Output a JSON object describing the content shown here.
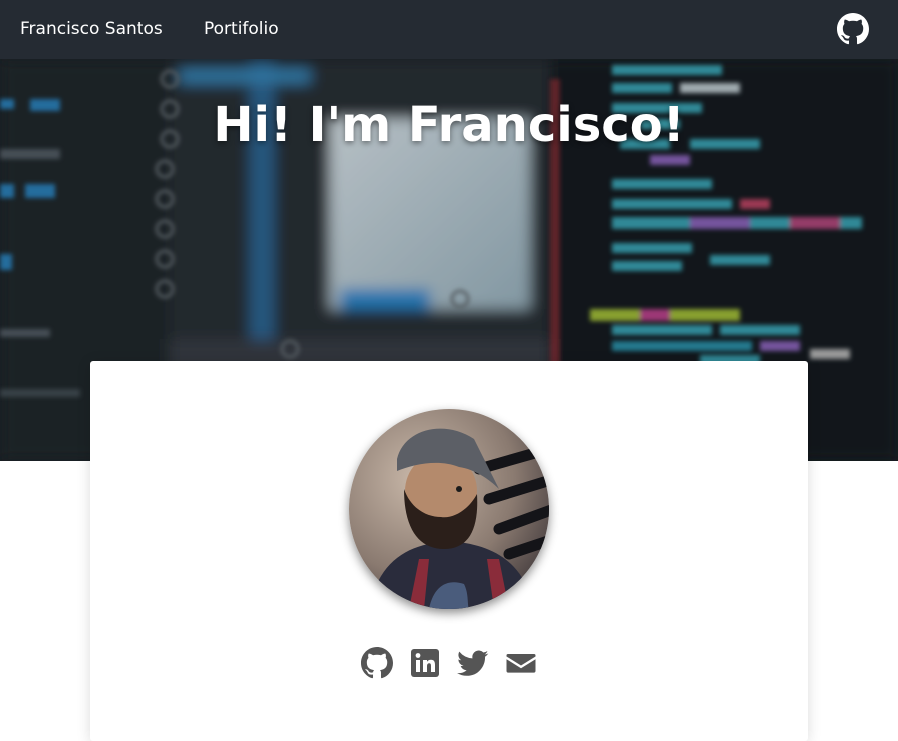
{
  "navbar": {
    "brand": "Francisco Santos",
    "portfolio_link": "Portifolio",
    "github_icon": "github-icon",
    "background": "#252b33"
  },
  "hero": {
    "title": "Hi! I'm Francisco!",
    "background_image": "blurred-code-editor-photo"
  },
  "profile": {
    "avatar": "profile-photo",
    "social_links": [
      {
        "icon": "github-icon"
      },
      {
        "icon": "linkedin-icon"
      },
      {
        "icon": "twitter-icon"
      },
      {
        "icon": "envelope-icon"
      }
    ],
    "icon_color": "#555555"
  }
}
